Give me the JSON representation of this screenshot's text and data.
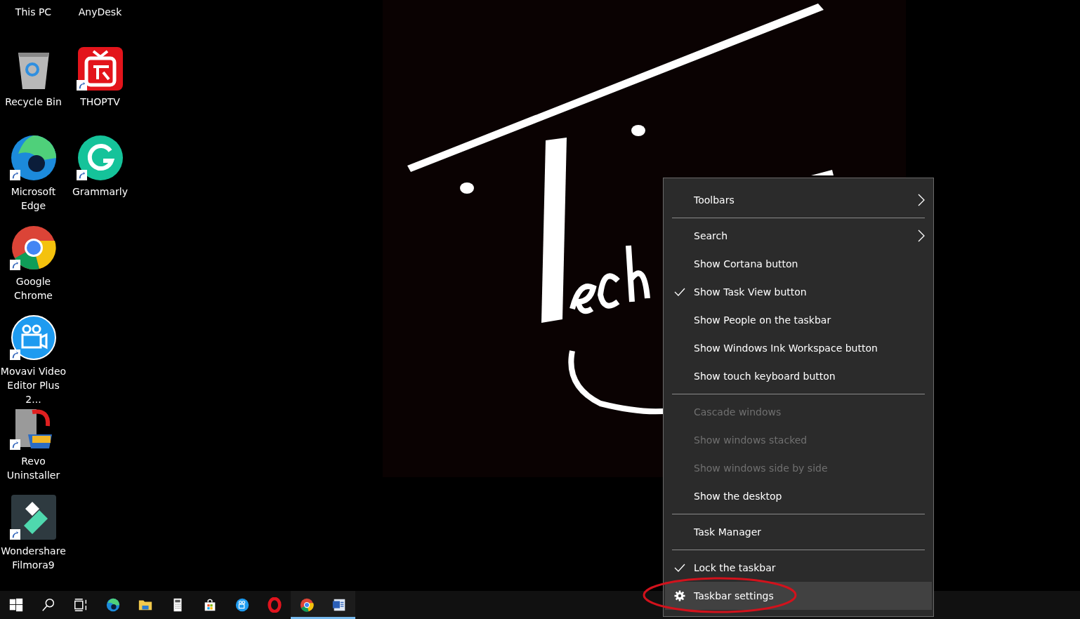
{
  "desktop_icons": [
    {
      "label": "This PC",
      "kind": "cut"
    },
    {
      "label": "Recycle Bin",
      "kind": "recycle",
      "shortcut": false
    },
    {
      "label": "Microsoft Edge",
      "kind": "edge",
      "shortcut": true
    },
    {
      "label": "Google Chrome",
      "kind": "chrome",
      "shortcut": true
    },
    {
      "label": "Movavi Video Editor Plus 2...",
      "kind": "movavi",
      "shortcut": true
    },
    {
      "label": "Revo Uninstaller",
      "kind": "revo",
      "shortcut": true
    },
    {
      "label": "Wondershare Filmora9",
      "kind": "filmora",
      "shortcut": true
    },
    {
      "label": "AnyDesk",
      "kind": "cut"
    },
    {
      "label": "THOPTV",
      "kind": "tv",
      "shortcut": true
    },
    {
      "label": "Grammarly",
      "kind": "grammarly",
      "shortcut": true
    }
  ],
  "context_menu": [
    {
      "kind": "item",
      "label": "Toolbars",
      "checked": false,
      "disabled": false,
      "submenu": true,
      "selected": false
    },
    {
      "kind": "separator"
    },
    {
      "kind": "item",
      "label": "Search",
      "checked": false,
      "disabled": false,
      "submenu": true,
      "selected": false
    },
    {
      "kind": "item",
      "label": "Show Cortana button",
      "checked": false,
      "disabled": false,
      "submenu": false,
      "selected": false
    },
    {
      "kind": "item",
      "label": "Show Task View button",
      "checked": true,
      "disabled": false,
      "submenu": false,
      "selected": false
    },
    {
      "kind": "item",
      "label": "Show People on the taskbar",
      "checked": false,
      "disabled": false,
      "submenu": false,
      "selected": false
    },
    {
      "kind": "item",
      "label": "Show Windows Ink Workspace button",
      "checked": false,
      "disabled": false,
      "submenu": false,
      "selected": false
    },
    {
      "kind": "item",
      "label": "Show touch keyboard button",
      "checked": false,
      "disabled": false,
      "submenu": false,
      "selected": false
    },
    {
      "kind": "separator"
    },
    {
      "kind": "item",
      "label": "Cascade windows",
      "checked": false,
      "disabled": true,
      "submenu": false,
      "selected": false
    },
    {
      "kind": "item",
      "label": "Show windows stacked",
      "checked": false,
      "disabled": true,
      "submenu": false,
      "selected": false
    },
    {
      "kind": "item",
      "label": "Show windows side by side",
      "checked": false,
      "disabled": true,
      "submenu": false,
      "selected": false
    },
    {
      "kind": "item",
      "label": "Show the desktop",
      "checked": false,
      "disabled": false,
      "submenu": false,
      "selected": false
    },
    {
      "kind": "separator"
    },
    {
      "kind": "item",
      "label": "Task Manager",
      "checked": false,
      "disabled": false,
      "submenu": false,
      "selected": false
    },
    {
      "kind": "separator"
    },
    {
      "kind": "item",
      "label": "Lock the taskbar",
      "checked": true,
      "disabled": false,
      "submenu": false,
      "selected": false
    },
    {
      "kind": "settings",
      "label": "Taskbar settings",
      "checked": false,
      "disabled": false,
      "submenu": false,
      "selected": true
    }
  ],
  "taskbar": [
    {
      "kind": "start",
      "running": false
    },
    {
      "kind": "search",
      "running": false
    },
    {
      "kind": "taskview",
      "running": false
    },
    {
      "kind": "edge",
      "running": false
    },
    {
      "kind": "folder",
      "running": false
    },
    {
      "kind": "calculator",
      "running": false
    },
    {
      "kind": "store",
      "running": false
    },
    {
      "kind": "movavi",
      "running": false
    },
    {
      "kind": "opera",
      "running": false
    },
    {
      "kind": "chrome",
      "running": true
    },
    {
      "kind": "word",
      "running": true
    }
  ]
}
